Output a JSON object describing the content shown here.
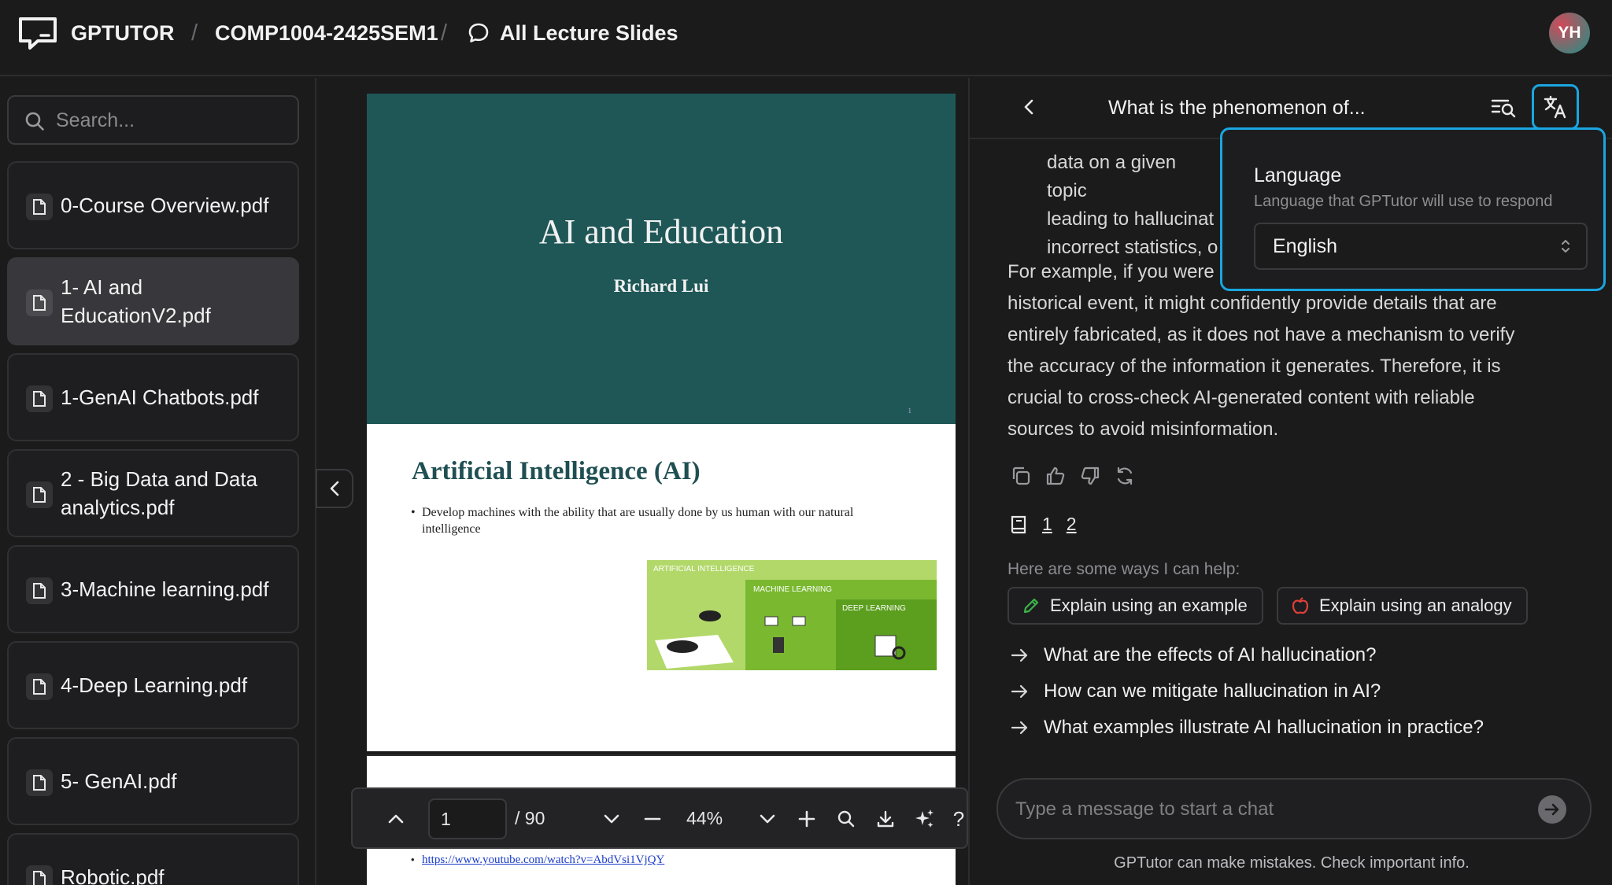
{
  "header": {
    "app_name": "GPTUTOR",
    "course": "COMP1004-2425SEM1",
    "section": "All Lecture Slides",
    "avatar_initials": "YH"
  },
  "sidebar": {
    "search_placeholder": "Search...",
    "files": [
      {
        "label": "0-Course Overview.pdf",
        "active": false
      },
      {
        "label": "1- AI and EducationV2.pdf",
        "active": true
      },
      {
        "label": "1-GenAI Chatbots.pdf",
        "active": false
      },
      {
        "label": "2 - Big Data and Data analytics.pdf",
        "active": false
      },
      {
        "label": "3-Machine learning.pdf",
        "active": false
      },
      {
        "label": "4-Deep Learning.pdf",
        "active": false
      },
      {
        "label": "5- GenAI.pdf",
        "active": false
      },
      {
        "label": "Robotic.pdf",
        "active": false
      }
    ]
  },
  "viewer": {
    "slide1": {
      "title": "AI and Education",
      "author": "Richard Lui",
      "page_mark": "1"
    },
    "slide2": {
      "title": "Artificial Intelligence (AI)",
      "bullet": "Develop machines with the ability that are usually done by us human with our natural intelligence",
      "graphic_labels": [
        "ARTIFICIAL INTELLIGENCE",
        "MACHINE LEARNING",
        "DEEP LEARNING"
      ]
    },
    "slide3": {
      "link": "https://www.youtube.com/watch?v=AbdVsi1VjQY"
    },
    "toolbar": {
      "page": "1",
      "total": "/ 90",
      "zoom": "44%"
    }
  },
  "chat": {
    "title": "What is the phenomenon of...",
    "partial_lines": [
      "data on a given topic",
      "leading to hallucinat",
      "incorrect statistics, o"
    ],
    "message": "For example, if you were asking about a historical event, it might confidently provide details that are entirely fabricated, as it does not have a mechanism to verify the accuracy of the information it generates. Therefore, it is crucial to cross-check AI-generated content with reliable sources to avoid misinformation.",
    "message_lines": [
      "For example, if you were",
      "historical event, it might confidently provide details that are",
      "entirely fabricated, as it does not have a mechanism to verify",
      "the accuracy of the information it generates. Therefore, it is",
      "crucial to cross-check AI-generated content with reliable",
      "sources to avoid misinformation."
    ],
    "sources": [
      "1",
      "2"
    ],
    "help_label": "Here are some ways I can help:",
    "chips": [
      "Explain using an example",
      "Explain using an analogy"
    ],
    "followups": [
      "What are the effects of AI hallucination?",
      "How can we mitigate hallucination in AI?",
      "What examples illustrate AI hallucination in practice?"
    ],
    "input_placeholder": "Type a message to start a chat",
    "disclaimer": "GPTutor can make mistakes. Check important info."
  },
  "language_popover": {
    "title": "Language",
    "description": "Language that GPTutor will use to respond",
    "selected": "English"
  },
  "colors": {
    "background": "#1b1b1c",
    "accent": "#1aa6e0",
    "slide_teal": "#1f5757",
    "slide_title": "#1f4f52"
  }
}
